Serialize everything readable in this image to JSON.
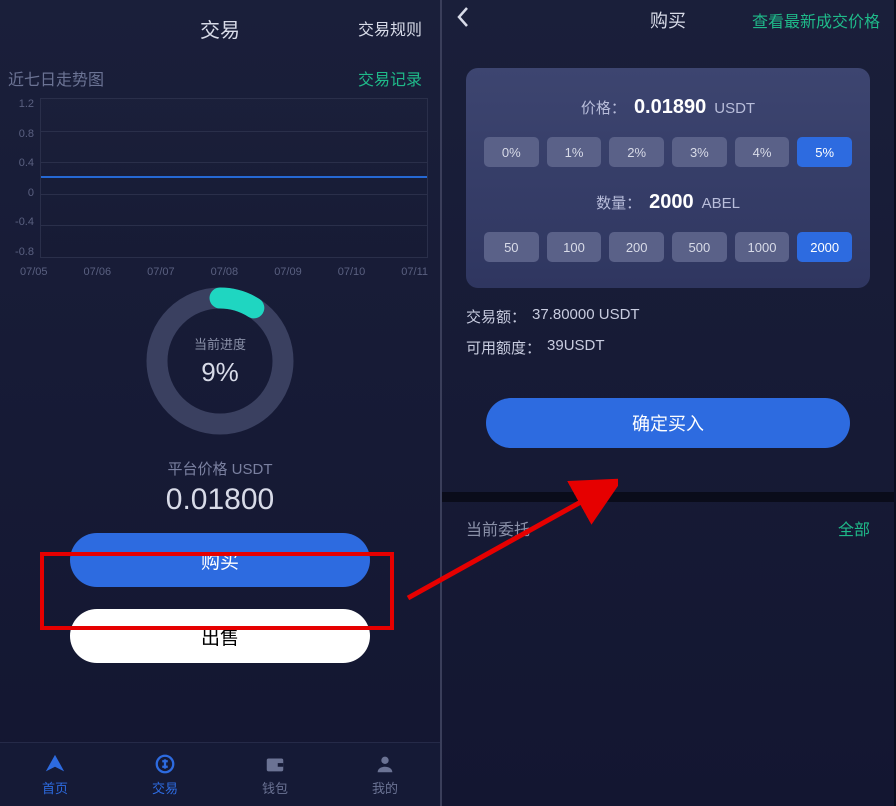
{
  "left": {
    "title": "交易",
    "rules_link": "交易规则",
    "chart_title": "近七日走势图",
    "records_link": "交易记录",
    "progress_label": "当前进度",
    "progress_value": "9%",
    "progress_percent": 9,
    "price_label": "平台价格 USDT",
    "price_value": "0.01800",
    "buy_btn": "购买",
    "sell_btn": "出售",
    "nav": [
      {
        "label": "首页",
        "icon": "home",
        "active": true
      },
      {
        "label": "交易",
        "icon": "trade",
        "active": true
      },
      {
        "label": "钱包",
        "icon": "wallet",
        "active": false
      },
      {
        "label": "我的",
        "icon": "profile",
        "active": false
      }
    ]
  },
  "right": {
    "title": "购买",
    "header_link": "查看最新成交价格",
    "price_label": "价格：",
    "price_value": "0.01890",
    "price_unit": "USDT",
    "pct_options": [
      "0%",
      "1%",
      "2%",
      "3%",
      "4%",
      "5%"
    ],
    "pct_selected": "5%",
    "qty_label": "数量：",
    "qty_value": "2000",
    "qty_unit": "ABEL",
    "qty_options": [
      "50",
      "100",
      "200",
      "500",
      "1000",
      "2000"
    ],
    "qty_selected": "2000",
    "trade_amount_label": "交易额：",
    "trade_amount_value": "37.80000 USDT",
    "available_label": "可用额度：",
    "available_value": "39USDT",
    "confirm_btn": "确定买入",
    "orders_title": "当前委托",
    "orders_link": "全部"
  },
  "chart_data": {
    "type": "line",
    "x": [
      "07/05",
      "07/06",
      "07/07",
      "07/08",
      "07/09",
      "07/10",
      "07/11"
    ],
    "values": [
      0.018,
      0.018,
      0.018,
      0.018,
      0.018,
      0.018,
      0.018
    ],
    "ylim": [
      -0.8,
      1.2
    ],
    "yticks": [
      1.2,
      0.8,
      0.4,
      0.0,
      -0.4,
      -0.8
    ],
    "title": "近七日走势图",
    "xlabel": "",
    "ylabel": ""
  }
}
